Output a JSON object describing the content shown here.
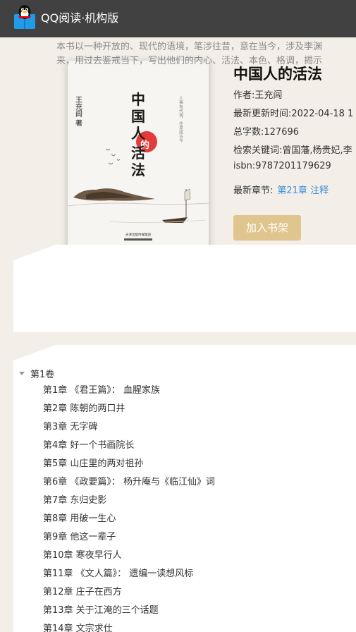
{
  "header": {
    "app_title": "QQ阅读·机构版"
  },
  "book": {
    "title": "中国人的活法",
    "author": "作者:王充闾",
    "updated": "最新更新时间:2022-04-18 1",
    "word_count": "总字数:127696",
    "keywords": "检索关键词:曾国藩,杨贵妃,李",
    "isbn": "isbn:9787201179629",
    "latest_label": "最新章节:",
    "latest_chapter": "第21章 注释",
    "add_button": "加入书架"
  },
  "cover": {
    "title_chars": [
      "中",
      "国",
      "人",
      "的",
      "活",
      "法"
    ],
    "author_text": "王充闾 著",
    "side_text": "人事有代谢，往来成古今",
    "publisher": "天津出版传媒集团"
  },
  "intro": {
    "line1": "本书以一种开放的、现代的语境，笔涉往昔，意在当今，涉及李渊",
    "line2": "来，用过去鉴戒当下，写出他们的内心、活法、本色、格调，揭示"
  },
  "toc": {
    "volume": "第1卷",
    "chapters": [
      "第1章 《君王篇》： 血腥家族",
      "第2章 陈朝的两口井",
      "第3章 无字碑",
      "第4章 好一个书画院长",
      "第5章 山庄里的两对祖孙",
      "第6章 《政要篇》： 杨升庵与《临江仙》词",
      "第7章 东归史影",
      "第8章 用破一生心",
      "第9章 他这一辈子",
      "第10章 寒夜早行人",
      "第11章 《文人篇》： 遗编一读想风标",
      "第12章 庄子在西方",
      "第13章 关于江淹的三个话题",
      "第14章 文宗求仕"
    ]
  },
  "colors": {
    "header_bg": "#414141",
    "page_bg": "#f3efe8",
    "button_bg": "#e0c58f",
    "link": "#3a8fd6"
  }
}
